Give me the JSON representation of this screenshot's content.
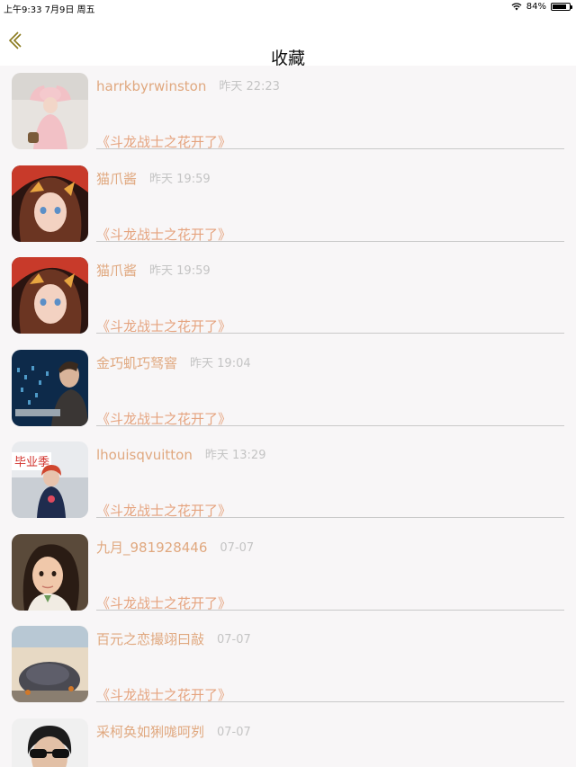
{
  "status_bar": {
    "time_date": "上午9:33   7月9日 周五",
    "battery_text": "84%",
    "battery_level": 0.84
  },
  "nav": {
    "title": "收藏",
    "back_icon": "chevron-left-icon"
  },
  "favorites": [
    {
      "username": "harrkbyrwinston",
      "time": "昨天 22:23",
      "title": "《斗龙战士之花开了》"
    },
    {
      "username": "猫爪酱",
      "time": "昨天 19:59",
      "title": "《斗龙战士之花开了》"
    },
    {
      "username": "猫爪酱",
      "time": "昨天 19:59",
      "title": "《斗龙战士之花开了》"
    },
    {
      "username": "金巧虮巧驽窨",
      "time": "昨天 19:04",
      "title": "《斗龙战士之花开了》"
    },
    {
      "username": "lhouisqvuitton",
      "time": "昨天 13:29",
      "title": "《斗龙战士之花开了》"
    },
    {
      "username": "九月_981928446",
      "time": "07-07",
      "title": "《斗龙战士之花开了》"
    },
    {
      "username": "百元之恋撮翊曰敲",
      "time": "07-07",
      "title": "《斗龙战士之花开了》"
    },
    {
      "username": "采柯奂如猁哤呵刿",
      "time": "07-07",
      "title": ""
    }
  ],
  "avatar_sign_text": "毕业季",
  "colors": {
    "username": "#e0a87f",
    "link": "#e5a37e",
    "time": "#c4c4c4",
    "background": "#f8f6f7"
  }
}
